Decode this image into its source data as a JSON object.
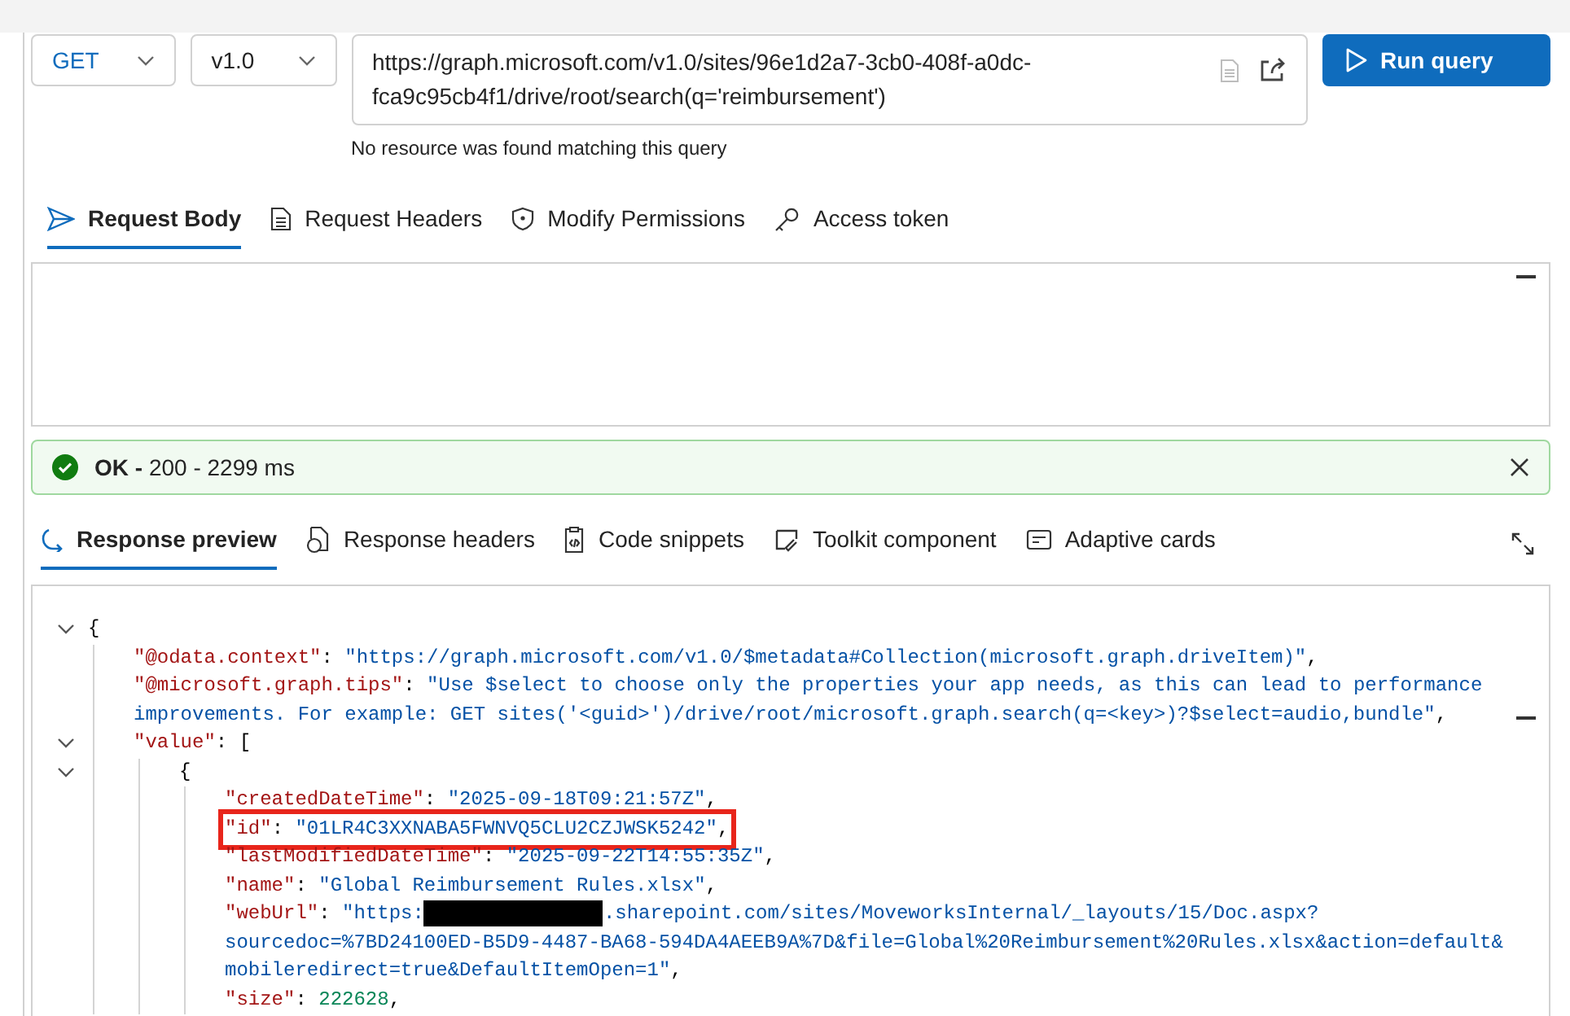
{
  "request": {
    "method": "GET",
    "version": "v1.0",
    "url": "https://graph.microsoft.com/v1.0/sites/96e1d2a7-3cb0-408f-a0dc-fca9c95cb4f1/drive/root/search(q='reimbursement')",
    "url_error": "No resource was found matching this query",
    "run_button": "Run query"
  },
  "request_tabs": [
    {
      "label": "Request Body",
      "selected": true
    },
    {
      "label": "Request Headers",
      "selected": false
    },
    {
      "label": "Modify Permissions",
      "selected": false
    },
    {
      "label": "Access token",
      "selected": false
    }
  ],
  "status": {
    "text": "**OK -** 200 - 2299 ms",
    "kind": "success"
  },
  "response_tabs": [
    {
      "label": "Response preview",
      "selected": true
    },
    {
      "label": "Response headers",
      "selected": false
    },
    {
      "label": "Code snippets",
      "selected": false
    },
    {
      "label": "Toolkit component",
      "selected": false
    },
    {
      "label": "Adaptive cards",
      "selected": false
    }
  ],
  "response": {
    "expanded": true,
    "open": "{",
    "children": [
      {
        "key": "\"@odata.context\"",
        "sep": ": ",
        "value": [
          {
            "kind": "string",
            "text": "\"https://graph.microsoft.com/v1.0/$metadata#Collection(microsoft.graph.driveItem)\""
          }
        ],
        "end": ","
      },
      {
        "key": "\"@microsoft.graph.tips\"",
        "sep": ": ",
        "value": [
          {
            "kind": "string",
            "text": "\"Use $select to choose only the properties your app needs, as this can lead to performance"
          },
          {
            "kind": "string",
            "wrap": true,
            "text": "improvements. For example: GET sites('<guid>')/drive/root/microsoft.graph.search(q=<key>)?$select=audio,bundle\""
          }
        ],
        "end": ","
      },
      {
        "expanded": true,
        "key": "\"value\"",
        "sep": ": ",
        "open": "[",
        "children": [
          {
            "expanded": true,
            "open": "{",
            "children": [
              {
                "key": "\"createdDateTime\"",
                "sep": ": ",
                "value": [
                  {
                    "kind": "string",
                    "text": "\"2025-09-18T09:21:57Z\""
                  }
                ],
                "end": ","
              },
              {
                "highlighted": true,
                "key": "\"id\"",
                "sep": ": ",
                "value": [
                  {
                    "kind": "string",
                    "text": "\"01LR4C3XXNABA5FWNVQ5CLU2CZJWSK5242\""
                  }
                ],
                "end": ","
              },
              {
                "key": "\"lastModifiedDateTime\"",
                "sep": ": ",
                "value": [
                  {
                    "kind": "string",
                    "text": "\"2025-09-22T14:55:35Z\""
                  }
                ],
                "end": ","
              },
              {
                "key": "\"name\"",
                "sep": ": ",
                "value": [
                  {
                    "kind": "string",
                    "text": "\"Global Reimbursement Rules.xlsx\""
                  }
                ],
                "end": ","
              },
              {
                "key": "\"webUrl\"",
                "sep": ": ",
                "value": [
                  {
                    "kind": "string",
                    "text": "\"https:"
                  },
                  {
                    "kind": "redacted"
                  },
                  {
                    "kind": "string",
                    "text": ".sharepoint.com/sites/MoveworksInternal/_layouts/15/Doc.aspx?"
                  },
                  {
                    "kind": "string",
                    "wrap": true,
                    "text": "sourcedoc=%7BD24100ED-B5D9-4487-BA68-594DA4AEEB9A%7D&file=Global%20Reimbursement%20Rules.xlsx&action=default&"
                  },
                  {
                    "kind": "string",
                    "wrap": true,
                    "text": "mobileredirect=true&DefaultItemOpen=1\""
                  }
                ],
                "end": ","
              },
              {
                "key": "\"size\"",
                "sep": ": ",
                "value": [
                  {
                    "kind": "number",
                    "text": "222628"
                  }
                ],
                "end": ","
              }
            ]
          }
        ]
      }
    ]
  }
}
